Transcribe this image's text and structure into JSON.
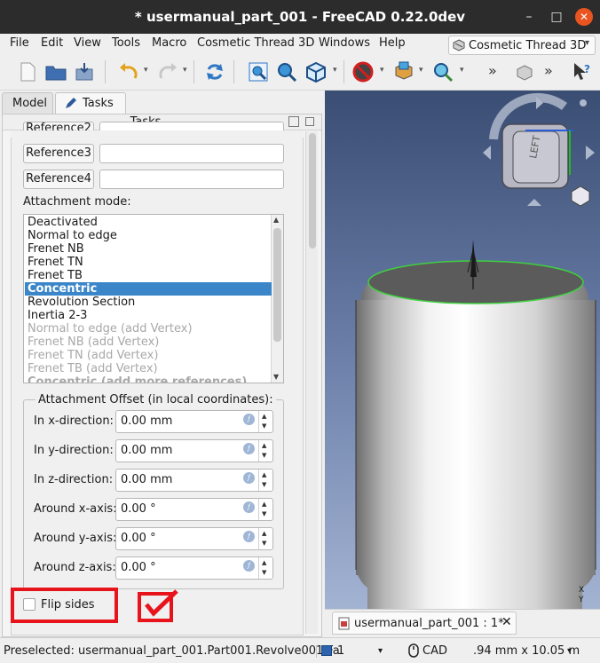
{
  "window": {
    "title": "* usermanual_part_001 - FreeCAD 0.22.0dev",
    "minimize_glyph": "–",
    "maximize_glyph": "□",
    "close_glyph": "✕"
  },
  "menubar": {
    "items": [
      "File",
      "Edit",
      "View",
      "Tools",
      "Macro",
      "Cosmetic Thread 3D",
      "Windows",
      "Help"
    ],
    "workbench": "Cosmetic Thread 3D"
  },
  "toolbar": {
    "overflow_glyph": "»"
  },
  "panel_tabs": [
    "Model",
    "Tasks"
  ],
  "tasks_header": "Tasks",
  "references": {
    "ref2_label": "Reference2",
    "ref3_label": "Reference3",
    "ref4_label": "Reference4",
    "ref2_value": "",
    "ref3_value": "",
    "ref4_value": ""
  },
  "attachment_mode": {
    "label": "Attachment mode:",
    "items": [
      {
        "text": "Deactivated",
        "state": "normal"
      },
      {
        "text": "Normal to edge",
        "state": "normal"
      },
      {
        "text": "Frenet NB",
        "state": "normal"
      },
      {
        "text": "Frenet TN",
        "state": "normal"
      },
      {
        "text": "Frenet TB",
        "state": "normal"
      },
      {
        "text": "Concentric",
        "state": "selected"
      },
      {
        "text": "Revolution Section",
        "state": "normal"
      },
      {
        "text": "Inertia 2-3",
        "state": "normal"
      },
      {
        "text": "Normal to edge (add Vertex)",
        "state": "disabled"
      },
      {
        "text": "Frenet NB (add Vertex)",
        "state": "disabled"
      },
      {
        "text": "Frenet TN (add Vertex)",
        "state": "disabled"
      },
      {
        "text": "Frenet TB (add Vertex)",
        "state": "disabled"
      },
      {
        "text": "Concentric (add more references)",
        "state": "disabled"
      }
    ]
  },
  "attachment_offset": {
    "title": "Attachment Offset (in local coordinates):",
    "fields": [
      {
        "label": "In x-direction:",
        "value": "0.00 mm"
      },
      {
        "label": "In y-direction:",
        "value": "0.00 mm"
      },
      {
        "label": "In z-direction:",
        "value": "0.00 mm"
      },
      {
        "label": "Around x-axis:",
        "value": "0.00 °"
      },
      {
        "label": "Around y-axis:",
        "value": "0.00 °"
      },
      {
        "label": "Around z-axis:",
        "value": "0.00 °"
      }
    ],
    "expression_glyph": "ƒ"
  },
  "flip_sides": {
    "label": "Flip sides",
    "checked": false
  },
  "navcube": {
    "face": "LEFT",
    "axis_x": "X",
    "axis_y": "Y"
  },
  "document_tab": {
    "title": "usermanual_part_001 : 1*",
    "close_glyph": "✕"
  },
  "statusbar": {
    "preselected": "Preselected: usermanual_part_001.Part001.Revolve001.Fa",
    "page": "1",
    "nav_style": "CAD",
    "dimensions": ".94 mm x 10.05 m"
  },
  "colors": {
    "accent": "#3a86c8",
    "highlight_red": "#e8141c",
    "close_button": "#e95420",
    "titlebar": "#2c2c2c"
  }
}
